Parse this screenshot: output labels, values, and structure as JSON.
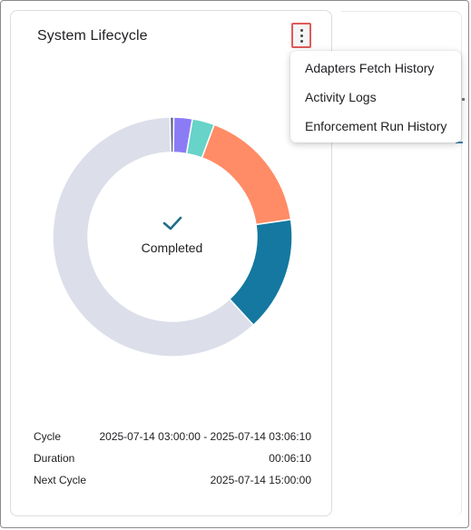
{
  "card": {
    "title": "System Lifecycle",
    "menu_icon": "more-vertical-icon"
  },
  "menu": {
    "items": [
      {
        "label": "Adapters Fetch History"
      },
      {
        "label": "Activity Logs"
      },
      {
        "label": "Enforcement Run History"
      }
    ]
  },
  "status": {
    "icon": "checkmark-icon",
    "label": "Completed"
  },
  "chart_data": {
    "type": "pie",
    "donut": true,
    "slices": [
      {
        "fraction": 0.005,
        "color": "#5b5f86"
      },
      {
        "fraction": 0.025,
        "color": "#8b7cf6"
      },
      {
        "fraction": 0.03,
        "color": "#67d3c9"
      },
      {
        "fraction": 0.17,
        "color": "#ff8c66"
      },
      {
        "fraction": 0.155,
        "color": "#1478a0"
      },
      {
        "fraction": 0.615,
        "color": "#dcdfea"
      }
    ]
  },
  "info": {
    "rows": [
      {
        "key": "Cycle",
        "value": "2025-07-14 03:00:00 - 2025-07-14 03:06:10"
      },
      {
        "key": "Duration",
        "value": "00:06:10"
      },
      {
        "key": "Next Cycle",
        "value": "2025-07-14 15:00:00"
      }
    ]
  },
  "colors": {
    "accent": "#e05a5a",
    "check": "#1f6f87"
  }
}
